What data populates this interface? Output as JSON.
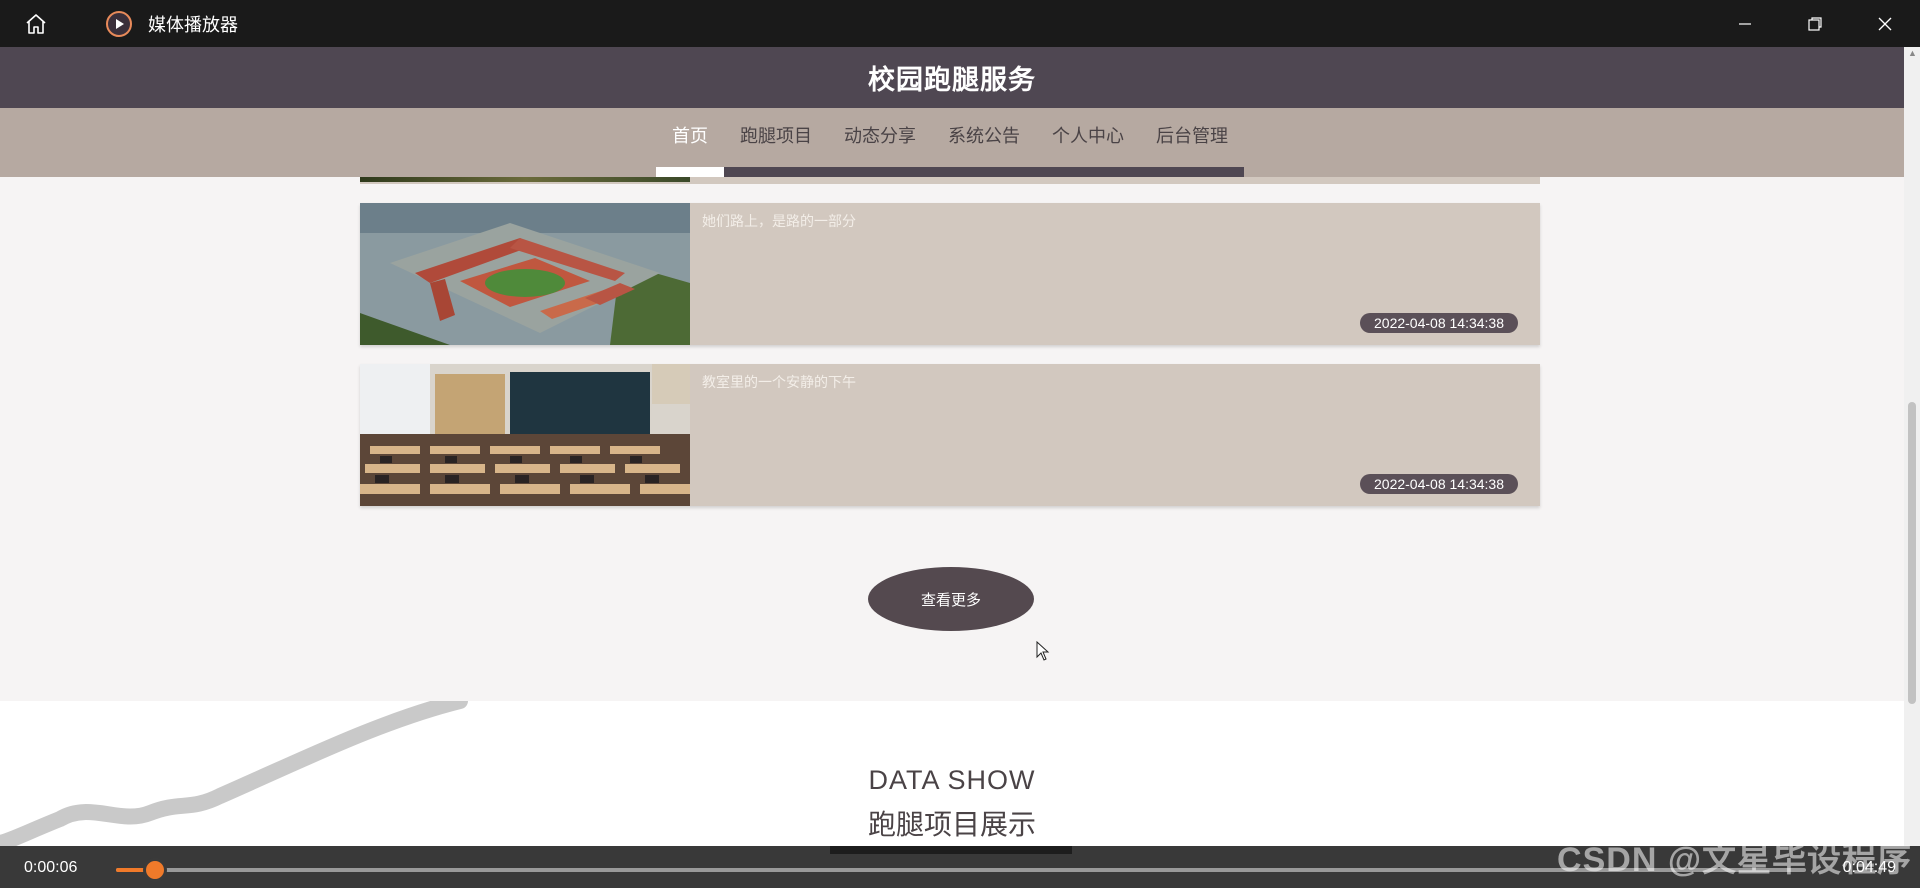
{
  "window": {
    "app_title": "媒体播放器",
    "home_icon": "home-icon",
    "app_icon": "play-circle-icon",
    "controls": [
      "minimize-icon",
      "restore-icon",
      "close-icon"
    ]
  },
  "site": {
    "title": "校园跑腿服务",
    "nav": [
      {
        "label": "首页",
        "active": true
      },
      {
        "label": "跑腿项目",
        "active": false
      },
      {
        "label": "动态分享",
        "active": false
      },
      {
        "label": "系统公告",
        "active": false
      },
      {
        "label": "个人中心",
        "active": false
      },
      {
        "label": "后台管理",
        "active": false
      }
    ]
  },
  "news": [
    {
      "title": "她们路上，是路的一部分",
      "date": "2022-04-08 14:34:38",
      "image": "campus-aerial-image"
    },
    {
      "title": "教室里的一个安静的下午",
      "date": "2022-04-08 14:34:38",
      "image": "classroom-image"
    }
  ],
  "more_button": "查看更多",
  "data_show": {
    "title": "DATA SHOW",
    "subtitle": "跑腿项目展示"
  },
  "player": {
    "current_time": "0:00:06",
    "total_time": "0:04:49",
    "progress": 0.023
  },
  "watermark": "CSDN @文星毕设程序",
  "colors": {
    "header": "#4f4752",
    "nav": "#b6a9a1",
    "card": "#d2c8bf",
    "accent": "#f07a2a"
  }
}
